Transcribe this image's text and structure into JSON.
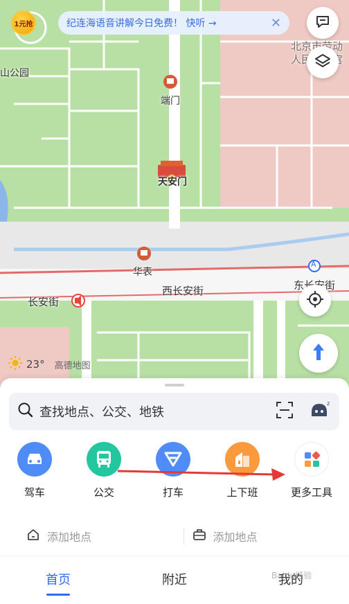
{
  "map": {
    "labels": {
      "park": "山公园",
      "duanmen": "端门",
      "tiananmen": "天安门",
      "huabiao": "华表",
      "xichangan": "西长安街",
      "changanjie": "长安街",
      "dongchangan": "东长安街",
      "workers_palace": "北京市劳动人民文化宫",
      "subway_a": "A"
    },
    "promo_badge": "1元抢",
    "notice": {
      "text": "纪连海语音讲解今日免费！ 快听 →",
      "close": "✕"
    },
    "weather": {
      "temp": "23°",
      "brand": "高德地图"
    },
    "icons": [
      "message-icon",
      "layers-icon",
      "locate-icon",
      "navigation-icon",
      "sun-icon"
    ]
  },
  "panel": {
    "search_placeholder": "查找地点、公交、地铁",
    "shortcuts": [
      {
        "label": "驾车",
        "color": "#4f8cf7",
        "icon": "car-icon"
      },
      {
        "label": "公交",
        "color": "#22c7a0",
        "icon": "bus-icon"
      },
      {
        "label": "打车",
        "color": "#4f8cf7",
        "icon": "taxi-icon"
      },
      {
        "label": "上下班",
        "color": "#fb9a3c",
        "icon": "commute-icon"
      },
      {
        "label": "更多工具",
        "color": "#ffffff",
        "icon": "more-tools-icon"
      }
    ],
    "home_address": "添加地点",
    "work_address": "添加地点"
  },
  "tabs": [
    {
      "label": "首页",
      "active": true
    },
    {
      "label": "附近",
      "active": false
    },
    {
      "label": "我的",
      "active": false
    }
  ],
  "watermark": "Baidu经验",
  "colors": {
    "accent": "#2f6bf2",
    "map_green": "#b8e0a4",
    "annotation": "#e53935"
  }
}
